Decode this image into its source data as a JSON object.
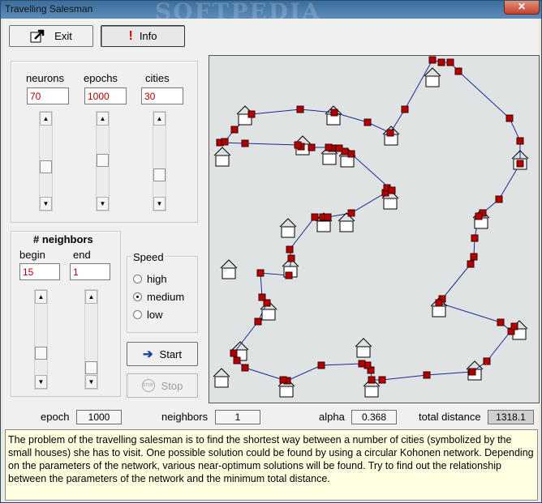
{
  "window": {
    "title": "Travelling Salesman",
    "watermark": "SOFTPEDIA",
    "close_label": "✕"
  },
  "toolbar": {
    "exit_label": "Exit",
    "info_label": "Info"
  },
  "parameters": {
    "neurons_label": "neurons",
    "neurons_value": "70",
    "epochs_label": "epochs",
    "epochs_value": "1000",
    "cities_label": "cities",
    "cities_value": "30"
  },
  "neighbors": {
    "title": "# neighbors",
    "begin_label": "begin",
    "begin_value": "15",
    "end_label": "end",
    "end_value": "1"
  },
  "speed": {
    "title": "Speed",
    "options": [
      "high",
      "medium",
      "low"
    ],
    "selected": "medium"
  },
  "actions": {
    "start_label": "Start",
    "stop_label": "Stop"
  },
  "status": {
    "epoch_label": "epoch",
    "epoch_value": "1000",
    "neighbors_label": "neighbors",
    "neighbors_value": "1",
    "alpha_label": "alpha",
    "alpha_value": "0.368",
    "total_distance_label": "total distance",
    "total_distance_value": "1318.1"
  },
  "description": "The problem of the travelling salesman is to find the shortest way between a number of cities (symbolized by the small houses) she has to visit. One possible solution could be found by using a circular Kohonen network. Depending on the parameters of the network, various near-optimum solutions will be found. Try to find out the relationship between the parameters of the network and the minimum total distance.",
  "colors": {
    "route_line": "#1a2a9a",
    "neuron": "#b00000",
    "map_bg": "#dfe3e3"
  }
}
